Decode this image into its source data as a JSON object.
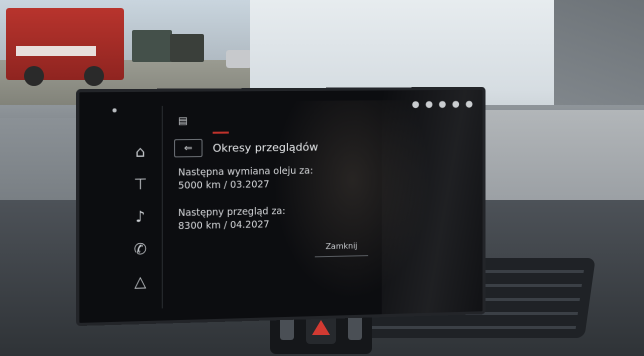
{
  "screen": {
    "title": "Okresy przeglądów",
    "items": [
      {
        "label": "Następna wymiana oleju za:",
        "value": "5000 km / 03.2027"
      },
      {
        "label": "Następny przegląd za:",
        "value": "8300 km / 04.2027"
      }
    ],
    "ok_button": "Zamknij",
    "sidebar_icons": [
      "home-icon",
      "navigation-icon",
      "music-icon",
      "phone-icon",
      "car-icon"
    ]
  },
  "colors": {
    "screen_bg": "#0c0d10",
    "accent_red": "#c0322b",
    "hazard_red": "#d23a32",
    "text": "#e6e8ea"
  }
}
